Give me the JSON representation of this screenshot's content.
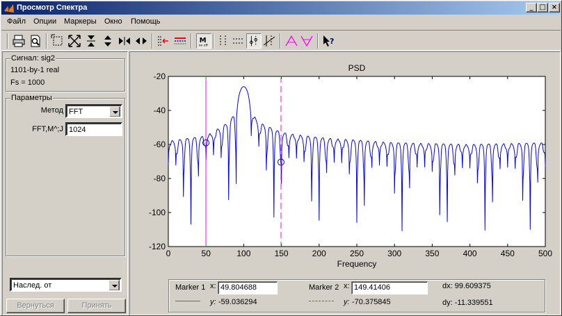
{
  "window": {
    "title": "Просмотр Спектра",
    "controls": [
      "_",
      "□",
      "×"
    ]
  },
  "menu": {
    "items": [
      "Файл",
      "Опции",
      "Маркеры",
      "Окно",
      "Помощь"
    ]
  },
  "toolbar": {
    "icons": [
      "print-icon",
      "print-preview-icon",
      "zoom-box-icon",
      "zoom-full-icon",
      "zoom-in-y-icon",
      "zoom-out-y-icon",
      "zoom-in-x-icon",
      "zoom-out-x-icon",
      "select-line-icon",
      "color-line-icon",
      "marker-toggle-icon",
      "vertical-markers-icon",
      "horizontal-markers-icon",
      "track-marker-icon",
      "slope-marker-icon",
      "peaks-icon",
      "valleys-icon",
      "whats-this-icon"
    ]
  },
  "signal": {
    "title": "Сигнал: sig2",
    "size": "1101-by-1 real",
    "fs": "Fs = 1000"
  },
  "params": {
    "title": "Параметры",
    "method_label": "Метод",
    "method_value": "FFT",
    "fft_label": "FFT,M^;J",
    "fft_value": "1024"
  },
  "inherit": {
    "value": "Наслед. от"
  },
  "buttons": {
    "revert": "Вернуться",
    "apply": "Принять"
  },
  "colors": {
    "curve": "#0000ff",
    "marker1": "#ff00ff",
    "marker2": "#ff00ff",
    "marker_cross": "#00ff00"
  },
  "chart_data": {
    "type": "line",
    "title": "PSD",
    "xlabel": "Frequency",
    "ylabel": "",
    "xlim": [
      0,
      500
    ],
    "ylim": [
      -120,
      -20
    ],
    "xticks": [
      "0",
      "50",
      "100",
      "150",
      "200",
      "250",
      "300",
      "350",
      "400",
      "450",
      "500"
    ],
    "yticks": [
      "-20",
      "-40",
      "-60",
      "-80",
      "-100",
      "-120"
    ],
    "series": [
      {
        "peak": {
          "x": 100,
          "y": -26
        },
        "sidelobe_spacing_hz": 10,
        "envelope": [
          {
            "x": 0,
            "y": -58
          },
          {
            "x": 50,
            "y": -55
          },
          {
            "x": 80,
            "y": -47
          },
          {
            "x": 90,
            "y": -41
          },
          {
            "x": 100,
            "y": -26
          },
          {
            "x": 110,
            "y": -41
          },
          {
            "x": 120,
            "y": -47
          },
          {
            "x": 150,
            "y": -53
          },
          {
            "x": 200,
            "y": -56
          },
          {
            "x": 300,
            "y": -59
          },
          {
            "x": 400,
            "y": -60
          },
          {
            "x": 500,
            "y": -59
          }
        ]
      }
    ],
    "markers": [
      {
        "x": 49.804688,
        "y": -59.036294,
        "style": "solid"
      },
      {
        "x": 149.41406,
        "y": -70.375845,
        "style": "dashed"
      }
    ]
  },
  "markers_panel": {
    "m1_label": "Marker 1",
    "m1_x_label": "x:",
    "m1_x": "49.804688",
    "m1_y_label": "y:",
    "m1_y": "-59.036294",
    "m2_label": "Marker 2",
    "m2_x_label": "x:",
    "m2_x": "149.41406",
    "m2_y_label": "y:",
    "m2_y": "-70.375845",
    "dx": "dx: 99.609375",
    "dy": "dy: -11.339551"
  }
}
